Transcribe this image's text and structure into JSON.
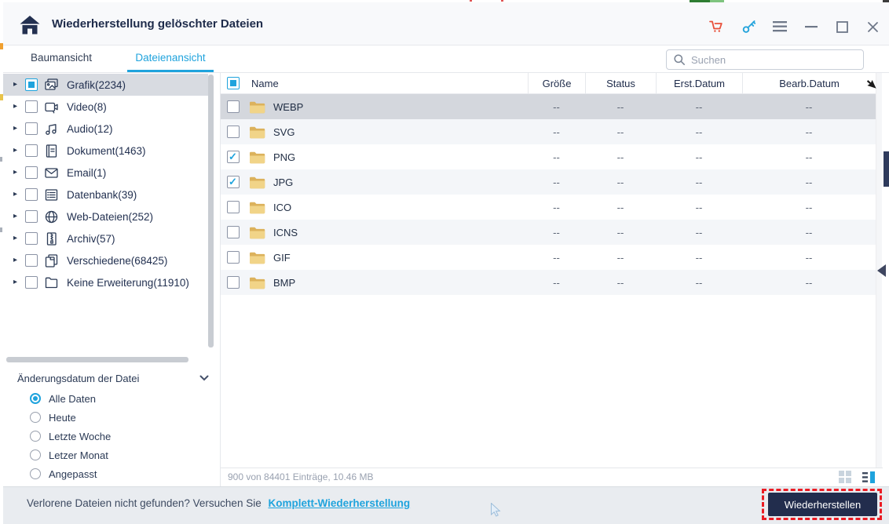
{
  "window": {
    "title": "Wiederherstellung gelöschter Dateien"
  },
  "titlebar": {
    "icons": [
      "home-icon",
      "cart-icon",
      "key-icon",
      "menu-icon",
      "minimize-icon",
      "maximize-icon",
      "close-icon"
    ]
  },
  "tabs": [
    {
      "label": "Baumansicht",
      "active": false
    },
    {
      "label": "Dateienansicht",
      "active": true
    }
  ],
  "search": {
    "placeholder": "Suchen",
    "value": ""
  },
  "sidebar": {
    "items": [
      {
        "label": "Grafik(2234)",
        "icon": "graphic-icon",
        "state": "indeterminate",
        "selected": true
      },
      {
        "label": "Video(8)",
        "icon": "video-icon",
        "state": "unchecked",
        "selected": false
      },
      {
        "label": "Audio(12)",
        "icon": "audio-icon",
        "state": "unchecked",
        "selected": false
      },
      {
        "label": "Dokument(1463)",
        "icon": "document-icon",
        "state": "unchecked",
        "selected": false
      },
      {
        "label": "Email(1)",
        "icon": "email-icon",
        "state": "unchecked",
        "selected": false
      },
      {
        "label": "Datenbank(39)",
        "icon": "database-icon",
        "state": "unchecked",
        "selected": false
      },
      {
        "label": "Web-Dateien(252)",
        "icon": "web-icon",
        "state": "unchecked",
        "selected": false
      },
      {
        "label": "Archiv(57)",
        "icon": "archive-icon",
        "state": "unchecked",
        "selected": false
      },
      {
        "label": "Verschiedene(68425)",
        "icon": "misc-icon",
        "state": "unchecked",
        "selected": false
      },
      {
        "label": "Keine Erweiterung(11910)",
        "icon": "no-extension-icon",
        "state": "unchecked",
        "selected": false
      }
    ]
  },
  "filter": {
    "title": "Änderungsdatum der Datei",
    "options": [
      {
        "label": "Alle Daten",
        "selected": true
      },
      {
        "label": "Heute",
        "selected": false
      },
      {
        "label": "Letzte Woche",
        "selected": false
      },
      {
        "label": "Letzer Monat",
        "selected": false
      },
      {
        "label": "Angepasst",
        "selected": false
      }
    ]
  },
  "table": {
    "header_checkbox_state": "indeterminate",
    "columns": [
      "Name",
      "Größe",
      "Status",
      "Erst.Datum",
      "Bearb.Datum"
    ],
    "rows": [
      {
        "name": "WEBP",
        "checked": false,
        "selected": true,
        "size": "--",
        "status": "--",
        "created": "--",
        "modified": "--"
      },
      {
        "name": "SVG",
        "checked": false,
        "selected": false,
        "size": "--",
        "status": "--",
        "created": "--",
        "modified": "--"
      },
      {
        "name": "PNG",
        "checked": true,
        "selected": false,
        "size": "--",
        "status": "--",
        "created": "--",
        "modified": "--"
      },
      {
        "name": "JPG",
        "checked": true,
        "selected": false,
        "size": "--",
        "status": "--",
        "created": "--",
        "modified": "--"
      },
      {
        "name": "ICO",
        "checked": false,
        "selected": false,
        "size": "--",
        "status": "--",
        "created": "--",
        "modified": "--"
      },
      {
        "name": "ICNS",
        "checked": false,
        "selected": false,
        "size": "--",
        "status": "--",
        "created": "--",
        "modified": "--"
      },
      {
        "name": "GIF",
        "checked": false,
        "selected": false,
        "size": "--",
        "status": "--",
        "created": "--",
        "modified": "--"
      },
      {
        "name": "BMP",
        "checked": false,
        "selected": false,
        "size": "--",
        "status": "--",
        "created": "--",
        "modified": "--"
      }
    ],
    "summary": "900 von 84401 Einträge, 10.46 MB"
  },
  "footer": {
    "hint": "Verlorene Dateien nicht gefunden? Versuchen Sie",
    "link": "Komplett-Wiederherstellung",
    "button": "Wiederherstellen"
  },
  "colors": {
    "accent": "#1fa3dd",
    "button_navy": "#222d4d",
    "annotation_red": "#ea1c24",
    "cart_red": "#e8503a",
    "selected_row": "#d4d7dd",
    "row_stripe": "#f4f6f9",
    "folder_yellow": "#f1d488"
  }
}
